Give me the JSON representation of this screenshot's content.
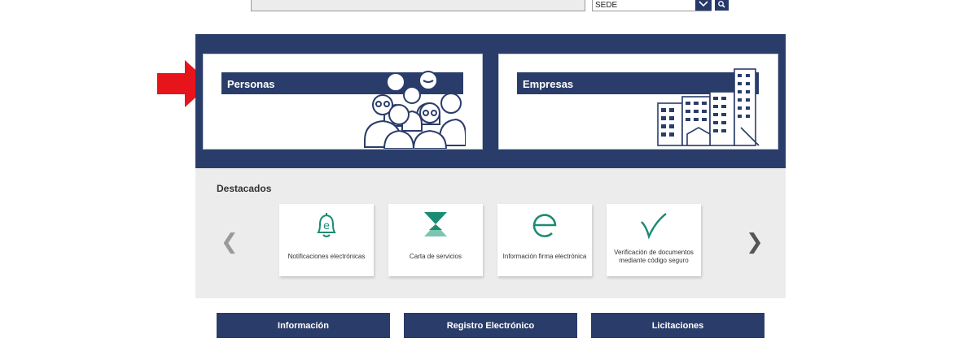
{
  "search": {
    "value": "",
    "sede_value": "SEDE"
  },
  "sections": {
    "personas": "Personas",
    "empresas": "Empresas"
  },
  "destacados": {
    "title": "Destacados",
    "prev": "❮",
    "next": "❯",
    "items": [
      {
        "label": "Notificaciones electrónicas",
        "icon": "bell-e-icon"
      },
      {
        "label": "Carta de servicios",
        "icon": "hourglass-icon"
      },
      {
        "label": "Información firma electrónica",
        "icon": "e-logo-icon"
      },
      {
        "label": "Verificación de documentos mediante código seguro",
        "icon": "checkmark-icon"
      }
    ]
  },
  "buttons": {
    "informacion": "Información",
    "registro": "Registro Electrónico",
    "licitaciones": "Licitaciones"
  },
  "colors": {
    "navy": "#2a3d6a",
    "teal": "#1b8c73",
    "arrow": "#e8141b",
    "panel_grey": "#ececec"
  }
}
